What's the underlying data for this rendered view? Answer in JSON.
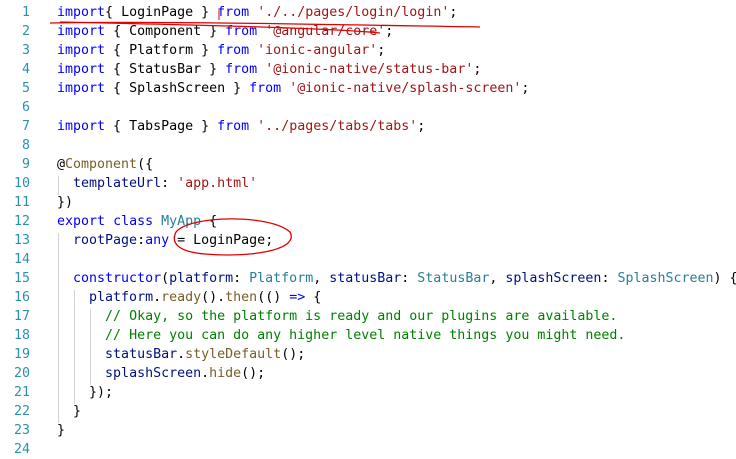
{
  "editor": {
    "lines": [
      {
        "n": "1",
        "tokens": [
          [
            "kw",
            "import"
          ],
          [
            "",
            "{ "
          ],
          [
            "",
            "LoginPage"
          ],
          [
            "",
            " } "
          ],
          [
            "kw",
            "from"
          ],
          [
            "",
            " "
          ],
          [
            "str",
            "'./../pages/login/login'"
          ],
          [
            "",
            ";"
          ]
        ]
      },
      {
        "n": "2",
        "tokens": [
          [
            "kw",
            "import"
          ],
          [
            "",
            "",
            " "
          ],
          [
            "",
            "{ Component } "
          ],
          [
            "kw",
            "from"
          ],
          [
            "",
            " "
          ],
          [
            "str",
            "'@angular/core'"
          ],
          [
            "",
            ";"
          ]
        ]
      },
      {
        "n": "3",
        "tokens": [
          [
            "kw",
            "import"
          ],
          [
            "",
            " { Platform } "
          ],
          [
            "kw",
            "from"
          ],
          [
            "",
            " "
          ],
          [
            "str",
            "'ionic-angular'"
          ],
          [
            "",
            ";"
          ]
        ]
      },
      {
        "n": "4",
        "tokens": [
          [
            "kw",
            "import"
          ],
          [
            "",
            " { StatusBar } "
          ],
          [
            "kw",
            "from"
          ],
          [
            "",
            " "
          ],
          [
            "str",
            "'@ionic-native/status-bar'"
          ],
          [
            "",
            ";"
          ]
        ]
      },
      {
        "n": "5",
        "tokens": [
          [
            "kw",
            "import"
          ],
          [
            "",
            " { SplashScreen } "
          ],
          [
            "kw",
            "from"
          ],
          [
            "",
            " "
          ],
          [
            "str",
            "'@ionic-native/splash-screen'"
          ],
          [
            "",
            ";"
          ]
        ]
      },
      {
        "n": "6",
        "tokens": []
      },
      {
        "n": "7",
        "tokens": [
          [
            "kw",
            "import"
          ],
          [
            "",
            " { TabsPage } "
          ],
          [
            "kw",
            "from"
          ],
          [
            "",
            " "
          ],
          [
            "str",
            "'../pages/tabs/tabs'"
          ],
          [
            "",
            ";"
          ]
        ]
      },
      {
        "n": "8",
        "tokens": []
      },
      {
        "n": "9",
        "tokens": [
          [
            "",
            "@"
          ],
          [
            "dc",
            "Component"
          ],
          [
            "",
            "({"
          ]
        ]
      },
      {
        "n": "10",
        "tokens": [
          [
            "",
            "  "
          ],
          [
            "vr",
            "templateUrl"
          ],
          [
            "",
            ": "
          ],
          [
            "str",
            "'app.html'"
          ]
        ]
      },
      {
        "n": "11",
        "tokens": [
          [
            "",
            "})"
          ]
        ]
      },
      {
        "n": "12",
        "tokens": [
          [
            "kw",
            "export"
          ],
          [
            "",
            " "
          ],
          [
            "kw",
            "class"
          ],
          [
            "",
            " "
          ],
          [
            "ty",
            "MyApp"
          ],
          [
            "",
            " {"
          ]
        ]
      },
      {
        "n": "13",
        "tokens": [
          [
            "",
            "  "
          ],
          [
            "vr",
            "rootPage"
          ],
          [
            "",
            ":"
          ],
          [
            "kw",
            "any"
          ],
          [
            "",
            " = "
          ],
          [
            "",
            "LoginPage"
          ],
          [
            "",
            ";"
          ]
        ]
      },
      {
        "n": "14",
        "tokens": []
      },
      {
        "n": "15",
        "tokens": [
          [
            "",
            "  "
          ],
          [
            "kw",
            "constructor"
          ],
          [
            "",
            "("
          ],
          [
            "vr",
            "platform"
          ],
          [
            "",
            ": "
          ],
          [
            "ty",
            "Platform"
          ],
          [
            "",
            ", "
          ],
          [
            "vr",
            "statusBar"
          ],
          [
            "",
            ": "
          ],
          [
            "ty",
            "StatusBar"
          ],
          [
            "",
            ", "
          ],
          [
            "vr",
            "splashScreen"
          ],
          [
            "",
            ": "
          ],
          [
            "ty",
            "SplashScreen"
          ],
          [
            "",
            ") {"
          ]
        ]
      },
      {
        "n": "16",
        "tokens": [
          [
            "",
            "    "
          ],
          [
            "vr",
            "platform"
          ],
          [
            "",
            "."
          ],
          [
            "fn",
            "ready"
          ],
          [
            "",
            "()."
          ],
          [
            "fn",
            "then"
          ],
          [
            "",
            "(() "
          ],
          [
            "kw",
            "=>"
          ],
          [
            "",
            " {"
          ]
        ]
      },
      {
        "n": "17",
        "tokens": [
          [
            "",
            "      "
          ],
          [
            "cmt",
            "// Okay, so the platform is ready and our plugins are available."
          ]
        ]
      },
      {
        "n": "18",
        "tokens": [
          [
            "",
            "      "
          ],
          [
            "cmt",
            "// Here you can do any higher level native things you might need."
          ]
        ]
      },
      {
        "n": "19",
        "tokens": [
          [
            "",
            "      "
          ],
          [
            "vr",
            "statusBar"
          ],
          [
            "",
            "."
          ],
          [
            "fn",
            "styleDefault"
          ],
          [
            "",
            "();"
          ]
        ]
      },
      {
        "n": "20",
        "tokens": [
          [
            "",
            "      "
          ],
          [
            "vr",
            "splashScreen"
          ],
          [
            "",
            "."
          ],
          [
            "fn",
            "hide"
          ],
          [
            "",
            "();"
          ]
        ]
      },
      {
        "n": "21",
        "tokens": [
          [
            "",
            "    });"
          ]
        ]
      },
      {
        "n": "22",
        "tokens": [
          [
            "",
            "  }"
          ]
        ]
      },
      {
        "n": "23",
        "tokens": [
          [
            "",
            "}"
          ]
        ]
      },
      {
        "n": "24",
        "tokens": []
      }
    ]
  },
  "colors": {
    "keyword": "#0000ff",
    "string": "#a31515",
    "comment": "#008000",
    "type": "#267f99",
    "function": "#795e26",
    "variable": "#001080",
    "line_number": "#2b91af",
    "annotation": "#e00000"
  }
}
